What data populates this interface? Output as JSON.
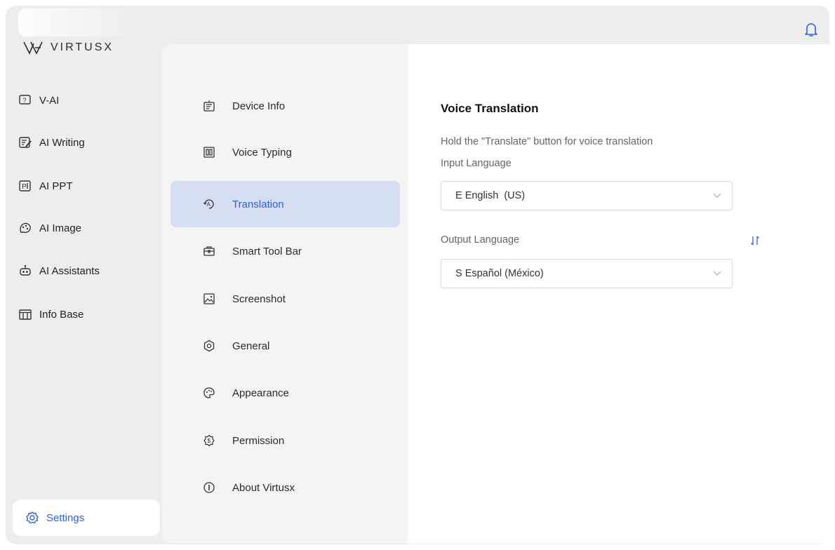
{
  "app": {
    "brand": "VIRTUSX"
  },
  "left_nav": {
    "items": [
      {
        "label": "V-AI",
        "icon": "chat-icon"
      },
      {
        "label": "AI Writing",
        "icon": "writing-icon"
      },
      {
        "label": "AI PPT",
        "icon": "ppt-icon"
      },
      {
        "label": "AI Image",
        "icon": "image-icon"
      },
      {
        "label": "AI Assistants",
        "icon": "robot-icon"
      },
      {
        "label": "Info Base",
        "icon": "database-icon"
      }
    ],
    "settings_label": "Settings"
  },
  "settings_nav": {
    "items": [
      {
        "label": "Device Info",
        "icon": "device-icon"
      },
      {
        "label": "Voice Typing",
        "icon": "voice-typing-icon"
      },
      {
        "label": "Translation",
        "icon": "translate-icon"
      },
      {
        "label": "Smart Tool Bar",
        "icon": "toolbox-icon"
      },
      {
        "label": "Screenshot",
        "icon": "screenshot-icon"
      },
      {
        "label": "General",
        "icon": "gear-icon"
      },
      {
        "label": "Appearance",
        "icon": "palette-icon"
      },
      {
        "label": "Permission",
        "icon": "shield-icon"
      },
      {
        "label": "About Virtusx",
        "icon": "info-icon"
      }
    ],
    "active_index": 2
  },
  "translation": {
    "title": "Voice Translation",
    "description": "Hold the \"Translate\" button for voice translation",
    "input_label": "Input Language",
    "input_value": "E English  (US)",
    "output_label": "Output Language",
    "output_value": "S Español (México)"
  },
  "colors": {
    "accent": "#2f63d8",
    "active_bg": "#d5def3",
    "sidebar_bg": "#ededed",
    "panel_bg": "#f4f4f4"
  }
}
